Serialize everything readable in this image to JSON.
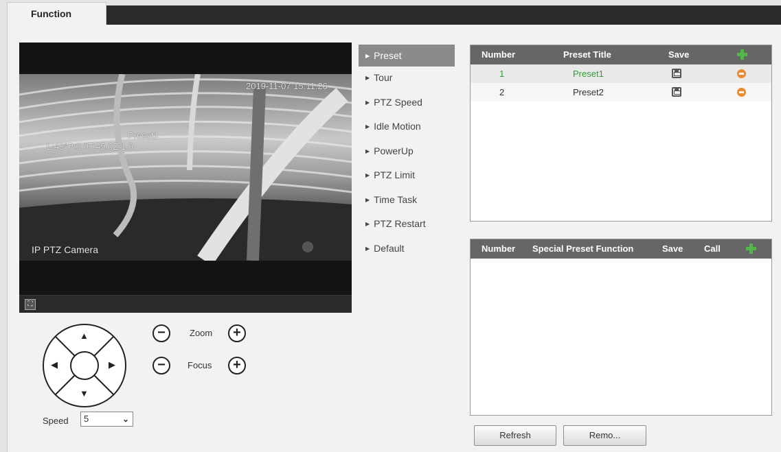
{
  "tab": {
    "title": "Function"
  },
  "video": {
    "timestamp": "2019-11-07 15:11:26",
    "preset_osd": "Preset1",
    "ptz_osd": "L:43°P:0.0T:45.0Z:1.0",
    "camera_name": "IP PTZ Camera"
  },
  "controls": {
    "zoom_label": "Zoom",
    "focus_label": "Focus",
    "speed_label": "Speed",
    "speed_value": "5"
  },
  "menu": {
    "items": [
      "Preset",
      "Tour",
      "PTZ Speed",
      "Idle Motion",
      "PowerUp",
      "PTZ Limit",
      "Time Task",
      "PTZ Restart",
      "Default"
    ],
    "active": "Preset"
  },
  "preset_table": {
    "headers": [
      "Number",
      "Preset Title",
      "Save"
    ],
    "rows": [
      {
        "number": "1",
        "title": "Preset1"
      },
      {
        "number": "2",
        "title": "Preset2"
      }
    ]
  },
  "special_table": {
    "headers": [
      "Number",
      "Special Preset Function",
      "Save",
      "Call"
    ]
  },
  "buttons": {
    "refresh": "Refresh",
    "remove": "Remo..."
  },
  "colors": {
    "header_bg": "#666666",
    "selected_text": "#2e9b2e",
    "add_icon": "#53b84a",
    "delete_icon": "#f08a2a"
  }
}
